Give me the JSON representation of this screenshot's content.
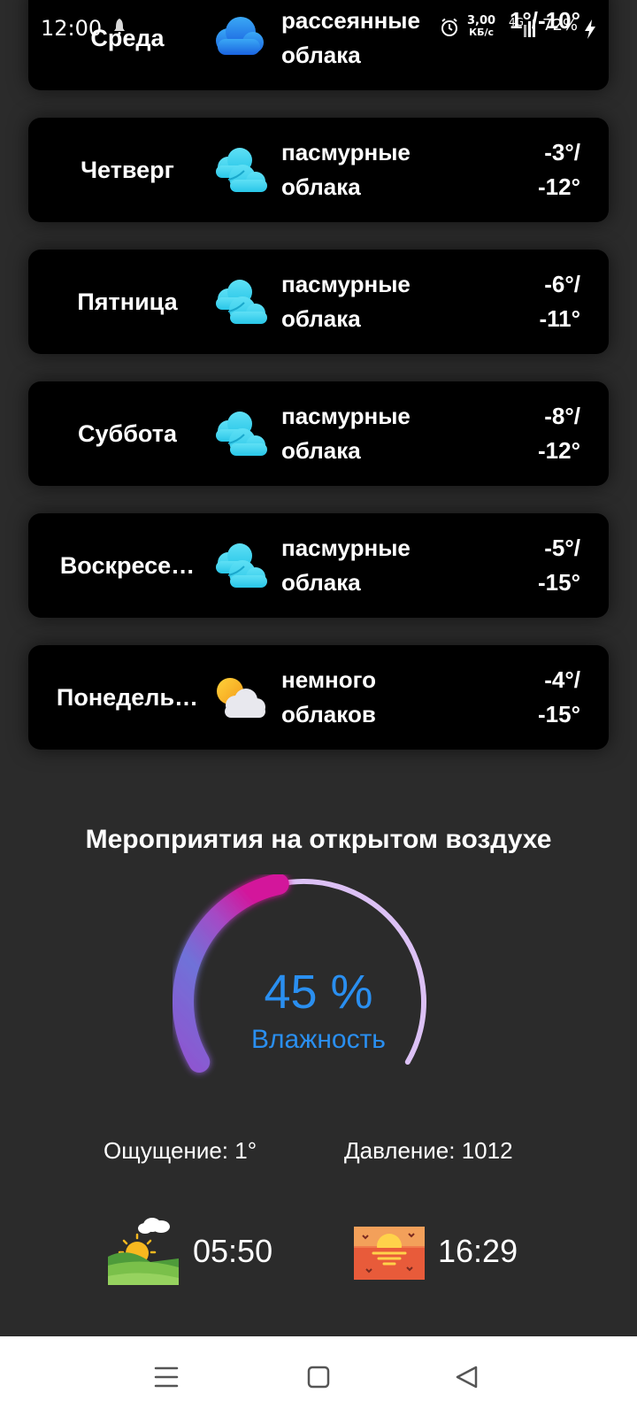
{
  "status_bar": {
    "time": "12:00",
    "speed_value": "3,00",
    "speed_unit": "КБ/с",
    "network": "4G",
    "battery": "72%"
  },
  "forecast": [
    {
      "day": "Среда",
      "desc_line1": "рассеянные",
      "desc_line2": "облака",
      "temp_line1": "1°/-10°",
      "temp_line2": "",
      "icon": "scattered-clouds-icon"
    },
    {
      "day": "Четверг",
      "desc_line1": "пасмурные",
      "desc_line2": "облака",
      "temp_line1": "-3°/",
      "temp_line2": "-12°",
      "icon": "overcast-clouds-icon"
    },
    {
      "day": "Пятница",
      "desc_line1": "пасмурные",
      "desc_line2": "облака",
      "temp_line1": "-6°/",
      "temp_line2": "-11°",
      "icon": "overcast-clouds-icon"
    },
    {
      "day": "Суббота",
      "desc_line1": "пасмурные",
      "desc_line2": "облака",
      "temp_line1": "-8°/",
      "temp_line2": "-12°",
      "icon": "overcast-clouds-icon"
    },
    {
      "day": "Воскресе…",
      "desc_line1": "пасмурные",
      "desc_line2": "облака",
      "temp_line1": "-5°/",
      "temp_line2": "-15°",
      "icon": "overcast-clouds-icon"
    },
    {
      "day": "Понедель…",
      "desc_line1": "немного",
      "desc_line2": "облаков",
      "temp_line1": "-4°/",
      "temp_line2": "-15°",
      "icon": "few-clouds-icon"
    }
  ],
  "outdoor": {
    "title": "Мероприятия на открытом воздухе",
    "humidity_value": "45 %",
    "humidity_label": "Влажность",
    "humidity_fraction": 0.45,
    "feels_like": "Ощущение: 1°",
    "pressure": "Давление: 1012",
    "sunrise": "05:50",
    "sunset": "16:29"
  },
  "colors": {
    "background": "#2b2b2b",
    "card": "#000000",
    "accent_blue": "#2a8ff0",
    "gauge_track": "#dcc1f5",
    "gauge_start": "#9b59d0",
    "gauge_end": "#d3169b"
  },
  "nav": {
    "icons": [
      "menu-icon",
      "home-square-icon",
      "back-triangle-icon"
    ]
  }
}
